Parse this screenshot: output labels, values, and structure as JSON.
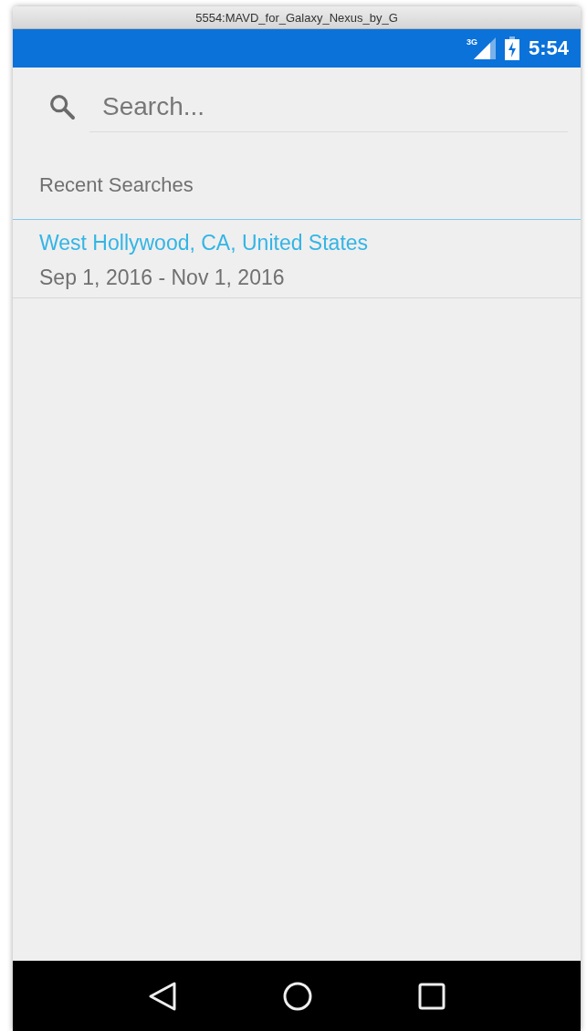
{
  "window": {
    "title": "5554:MAVD_for_Galaxy_Nexus_by_G"
  },
  "status_bar": {
    "network_type": "3G",
    "time": "5:54"
  },
  "search": {
    "placeholder": "Search..."
  },
  "recent_searches": {
    "heading": "Recent Searches",
    "items": [
      {
        "place": "West Hollywood, CA, United States",
        "dates": "Sep 1, 2016 - Nov 1, 2016"
      }
    ]
  }
}
